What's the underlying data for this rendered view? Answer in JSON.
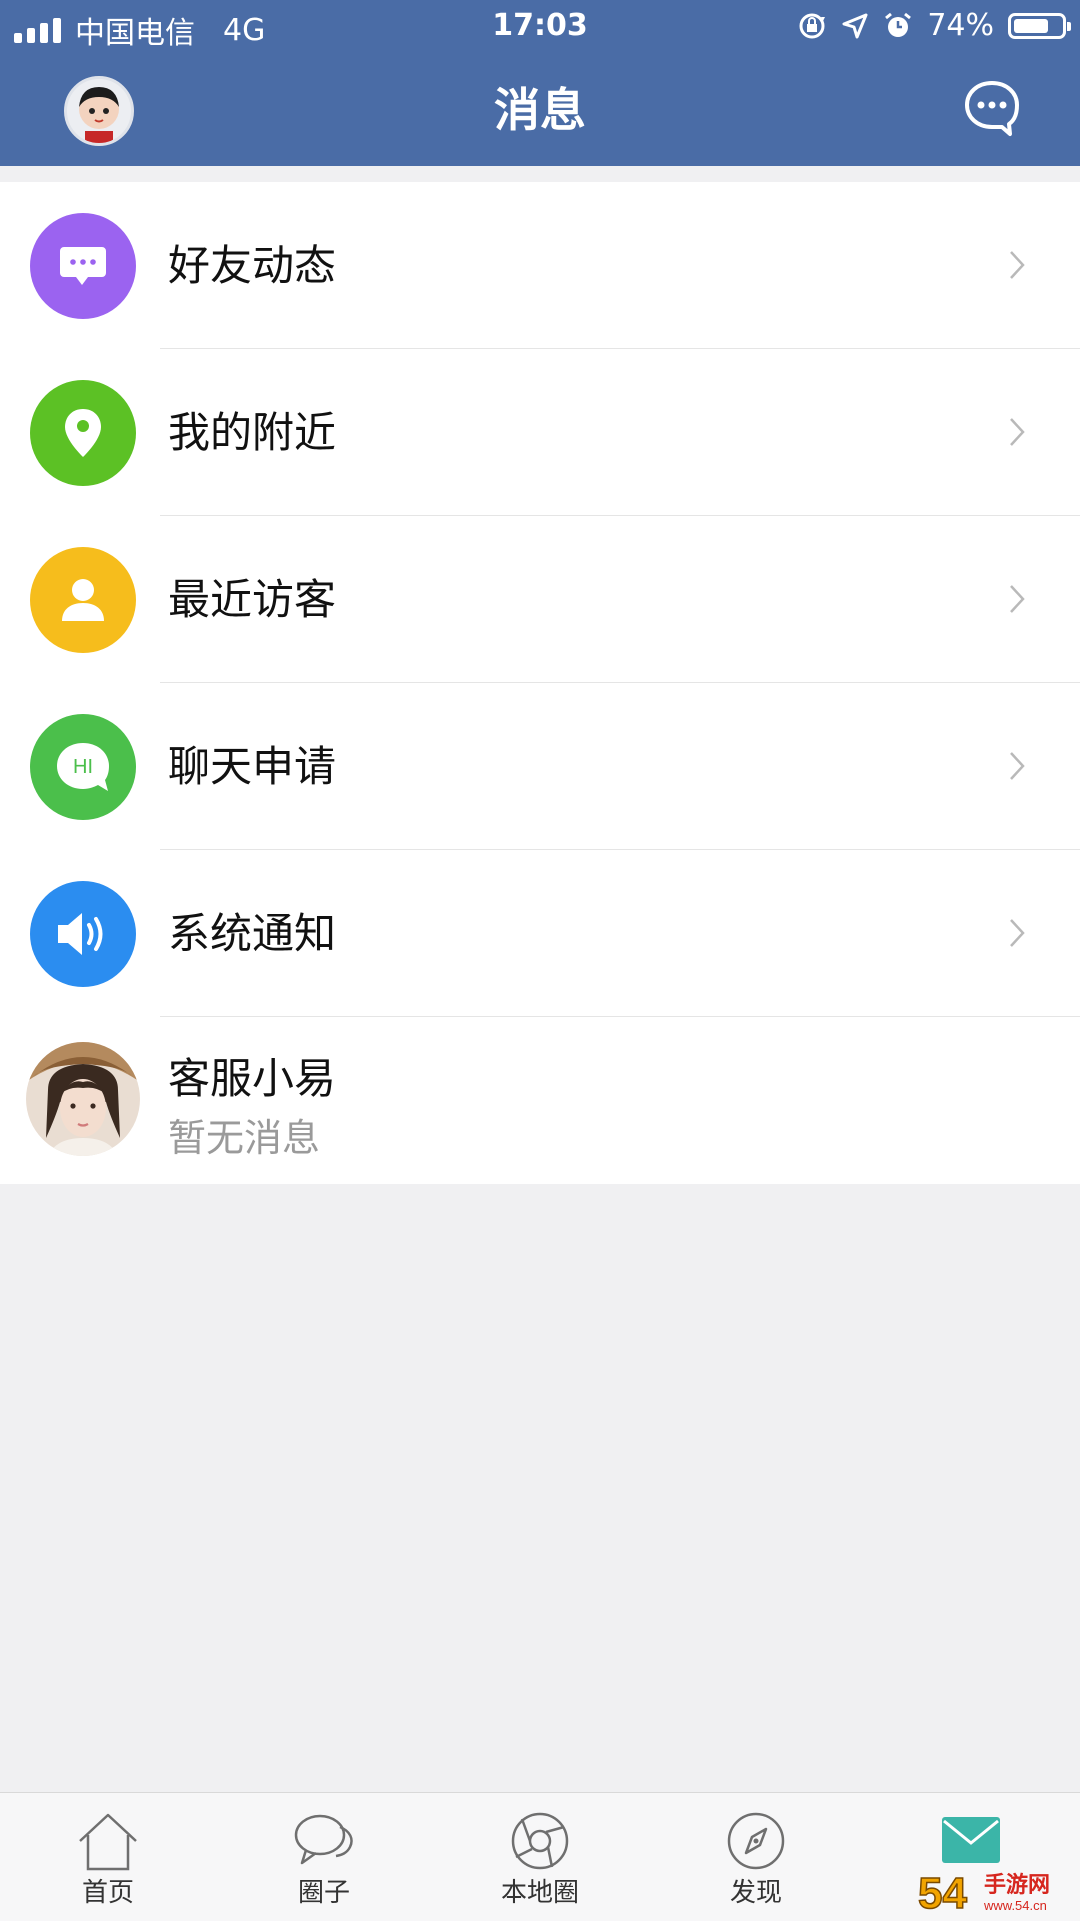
{
  "status_bar": {
    "carrier": "中国电信",
    "network": "4G",
    "time": "17:03",
    "battery": "74%",
    "battery_level": 0.74
  },
  "nav": {
    "title": "消息"
  },
  "list": {
    "items": [
      {
        "label": "好友动态",
        "icon": "message-bubble-icon",
        "color": "#9b63f0"
      },
      {
        "label": "我的附近",
        "icon": "location-pin-icon",
        "color": "#5cc125"
      },
      {
        "label": "最近访客",
        "icon": "person-icon",
        "color": "#f6bd1c"
      },
      {
        "label": "聊天申请",
        "icon": "hi-bubble-icon",
        "color": "#4bbf4b",
        "icon_text": "HI"
      },
      {
        "label": "系统通知",
        "icon": "speaker-icon",
        "color": "#2b8df0"
      }
    ],
    "contact": {
      "name": "客服小易",
      "preview": "暂无消息"
    }
  },
  "tabbar": {
    "tabs": [
      {
        "label": "首页",
        "icon": "home-icon"
      },
      {
        "label": "圈子",
        "icon": "chat-bubbles-icon"
      },
      {
        "label": "本地圈",
        "icon": "aperture-icon"
      },
      {
        "label": "发现",
        "icon": "compass-icon"
      },
      {
        "label": "",
        "icon": "mail-icon"
      }
    ],
    "active_color": "#3bb5a8"
  },
  "watermark": {
    "text_number": "54",
    "text_cn": "手游网",
    "text_domain": "www.54.cn"
  }
}
